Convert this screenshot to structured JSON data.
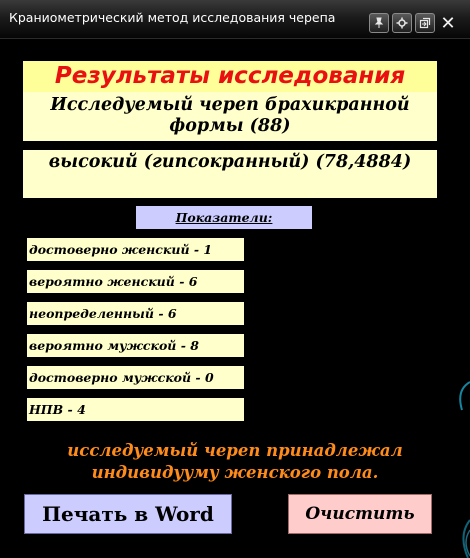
{
  "window": {
    "title": "Краниометрический метод исследования черепа",
    "controls": {
      "pin_icon": "pin-icon",
      "gear_icon": "gear-icon",
      "restore_icon": "restore-icon",
      "close_icon": "close-icon"
    }
  },
  "results": {
    "heading": "Результаты исследования",
    "skull_shape": "Исследуемый череп брахикранной формы (88)",
    "skull_height": "высокий (гипсокранный) (78,4884)"
  },
  "indicators": {
    "label": "Показатели:",
    "items": [
      "достоверно женский - 1",
      "вероятно женский - 6",
      "неопределенный - 6",
      "вероятно мужской - 8",
      "достоверно мужской - 0",
      "НПВ - 4"
    ]
  },
  "conclusion": "исследуемый череп принадлежал индивидууму женского пола.",
  "buttons": {
    "print_word": "Печать в Word",
    "clear": "Очистить"
  },
  "colors": {
    "background": "#000000",
    "heading_bg": "#ffff99",
    "heading_text": "#e81010",
    "panel_bg": "#ffffcc",
    "label_bg": "#ccccff",
    "conclusion_text": "#ff8c1a",
    "clear_button_bg": "#ffcccc"
  }
}
